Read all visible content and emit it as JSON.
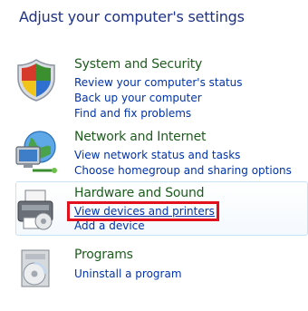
{
  "title": "Adjust your computer's settings",
  "categories": [
    {
      "heading": "System and Security",
      "icon": "shield-icon",
      "links": [
        "Review your computer's status",
        "Back up your computer",
        "Find and fix problems"
      ]
    },
    {
      "heading": "Network and Internet",
      "icon": "network-globe-icon",
      "links": [
        "View network status and tasks",
        "Choose homegroup and sharing options"
      ]
    },
    {
      "heading": "Hardware and Sound",
      "icon": "printer-icon",
      "links": [
        "View devices and printers",
        "Add a device"
      ]
    },
    {
      "heading": "Programs",
      "icon": "programs-disc-icon",
      "links": [
        "Uninstall a program"
      ]
    }
  ],
  "colors": {
    "title": "#1e3287",
    "heading": "#1e5c1e",
    "link": "#0033aa",
    "highlight": "#e3101d"
  }
}
